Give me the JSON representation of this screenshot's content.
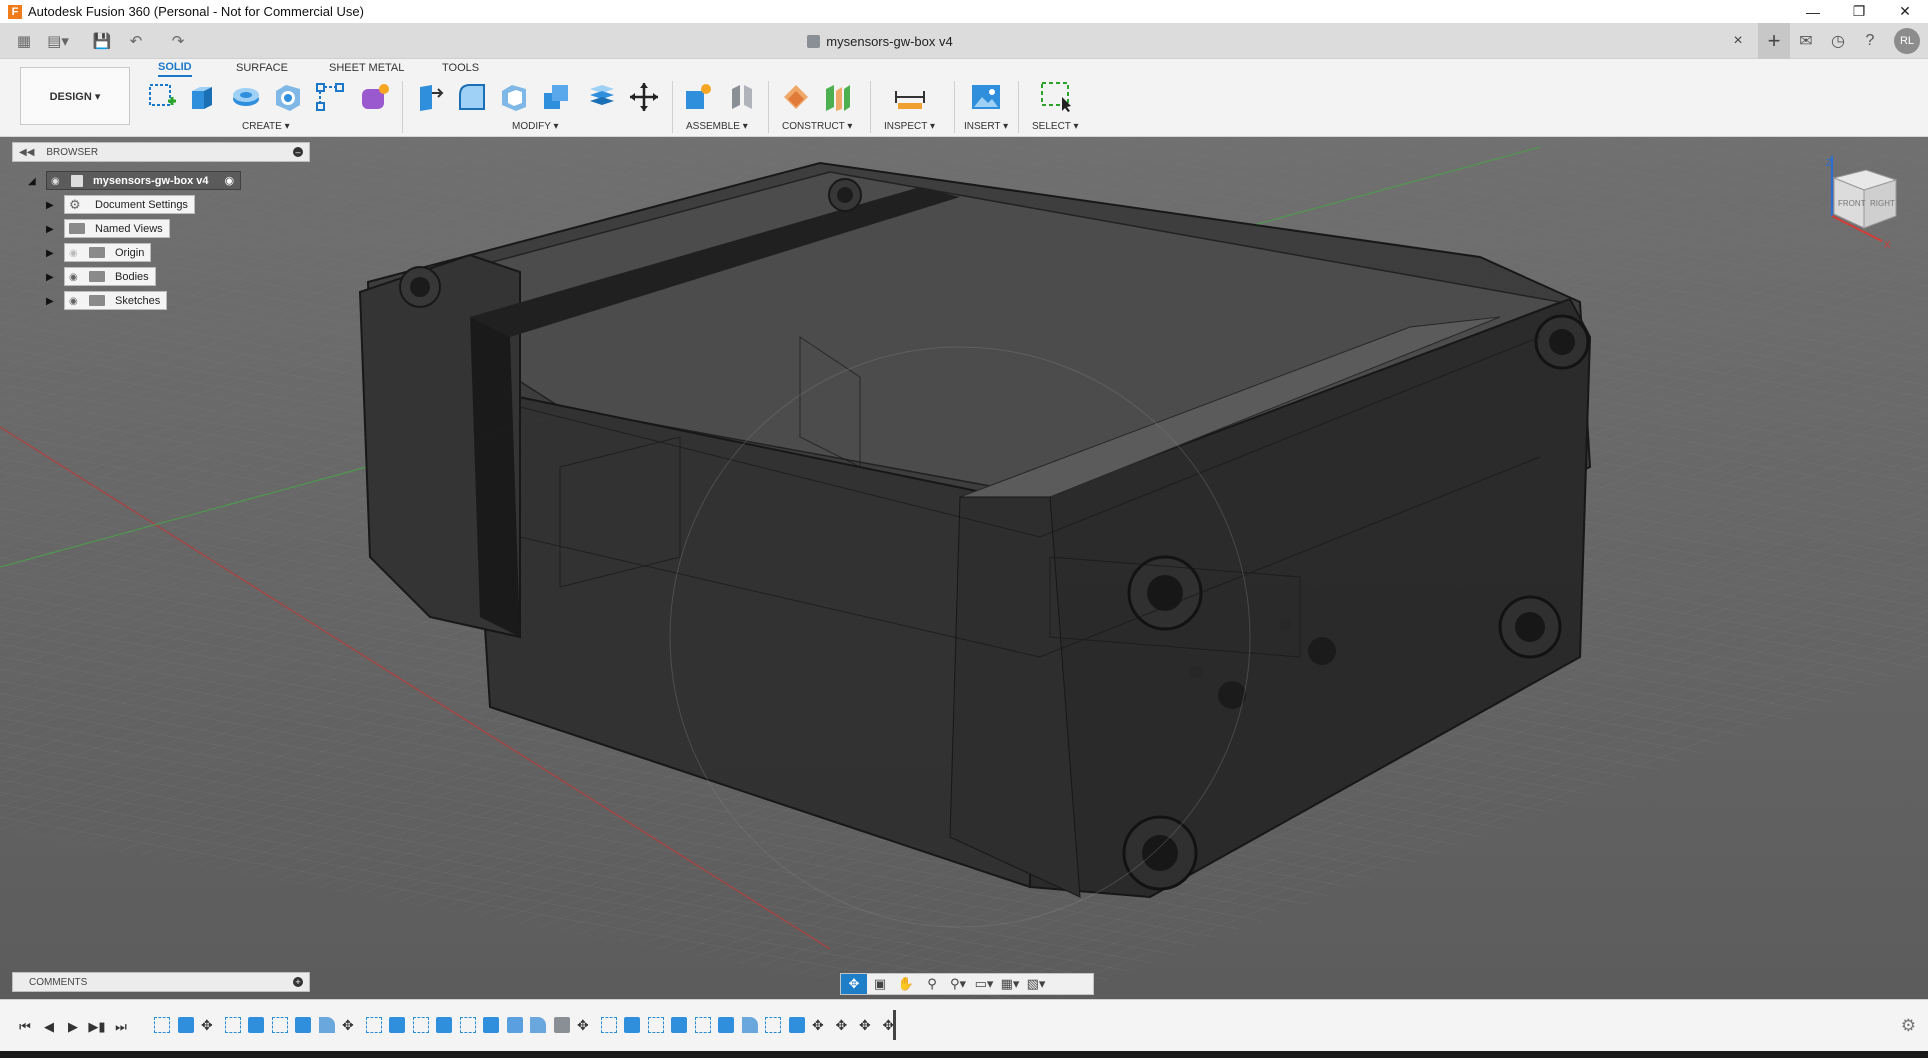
{
  "window": {
    "title": "Autodesk Fusion 360 (Personal - Not for Commercial Use)",
    "controls": [
      "minimize",
      "restore",
      "close"
    ]
  },
  "document": {
    "tab_title": "mysensors-gw-box v4",
    "close_symbol": "×",
    "user_initials": "RL"
  },
  "toolbar": {
    "workspace": "DESIGN ▾",
    "tabs": [
      "SOLID",
      "SURFACE",
      "SHEET METAL",
      "TOOLS"
    ],
    "active_tab": "SOLID",
    "groups": {
      "create": "CREATE ▾",
      "modify": "MODIFY ▾",
      "assemble": "ASSEMBLE ▾",
      "construct": "CONSTRUCT ▾",
      "inspect": "INSPECT ▾",
      "insert": "INSERT ▾",
      "select": "SELECT ▾"
    }
  },
  "browser": {
    "header": "BROWSER",
    "root": "mysensors-gw-box v4",
    "items": [
      {
        "label": "Document Settings",
        "icon": "gear-icon"
      },
      {
        "label": "Named Views",
        "icon": "folder-icon"
      },
      {
        "label": "Origin",
        "icon": "folder-icon"
      },
      {
        "label": "Bodies",
        "icon": "folder-icon"
      },
      {
        "label": "Sketches",
        "icon": "folder-icon"
      }
    ]
  },
  "comments": {
    "header": "COMMENTS"
  },
  "viewcube": {
    "front": "FRONT",
    "right": "RIGHT"
  },
  "colors": {
    "accent": "#1b78c9",
    "viewport_bg": "#6a6a6a",
    "model_body": "#2b2b2b"
  }
}
